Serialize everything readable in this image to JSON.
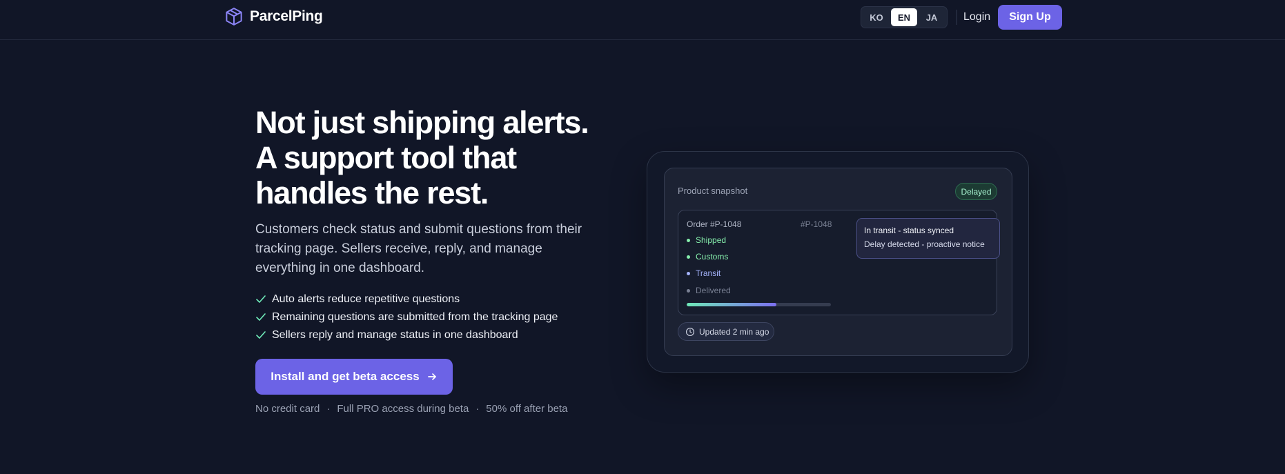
{
  "brand": {
    "name": "ParcelPing",
    "icon": "box-icon",
    "accent": "#6c63e6"
  },
  "nav": {
    "languages": [
      {
        "code": "KO",
        "active": false
      },
      {
        "code": "EN",
        "active": true
      },
      {
        "code": "JA",
        "active": false
      }
    ],
    "login_label": "Login",
    "signup_label": "Sign Up"
  },
  "hero": {
    "title_lines": [
      "Not just shipping alerts.",
      "A support tool that",
      "handles the rest."
    ],
    "subtitle": "Customers check status and submit questions from their tracking page. Sellers receive, reply, and manage everything in one dashboard.",
    "checks": [
      "Auto alerts reduce repetitive questions",
      "Remaining questions are submitted from the tracking page",
      "Sellers reply and manage status in one dashboard"
    ],
    "cta_label": "Install and get beta access",
    "cta_icon": "arrow-right-icon",
    "notes": [
      "No credit card",
      "Full PRO access during beta",
      "50% off after beta"
    ],
    "note_separator": "·"
  },
  "preview": {
    "label": "Product snapshot",
    "badge": "Delayed",
    "order_title": "Order #P-1048",
    "order_id": "#P-1048",
    "steps": [
      {
        "label": "Shipped",
        "color": "#86efac"
      },
      {
        "label": "Customs",
        "color": "#86efac"
      },
      {
        "label": "Transit",
        "color": "#a5b4fc"
      },
      {
        "label": "Delivered",
        "color": "#7a8194"
      }
    ],
    "progress_percent": 62,
    "tooltip_lines": [
      "In transit - status synced",
      "Delay detected - proactive notice"
    ],
    "updated_label": "Updated 2 min ago"
  }
}
